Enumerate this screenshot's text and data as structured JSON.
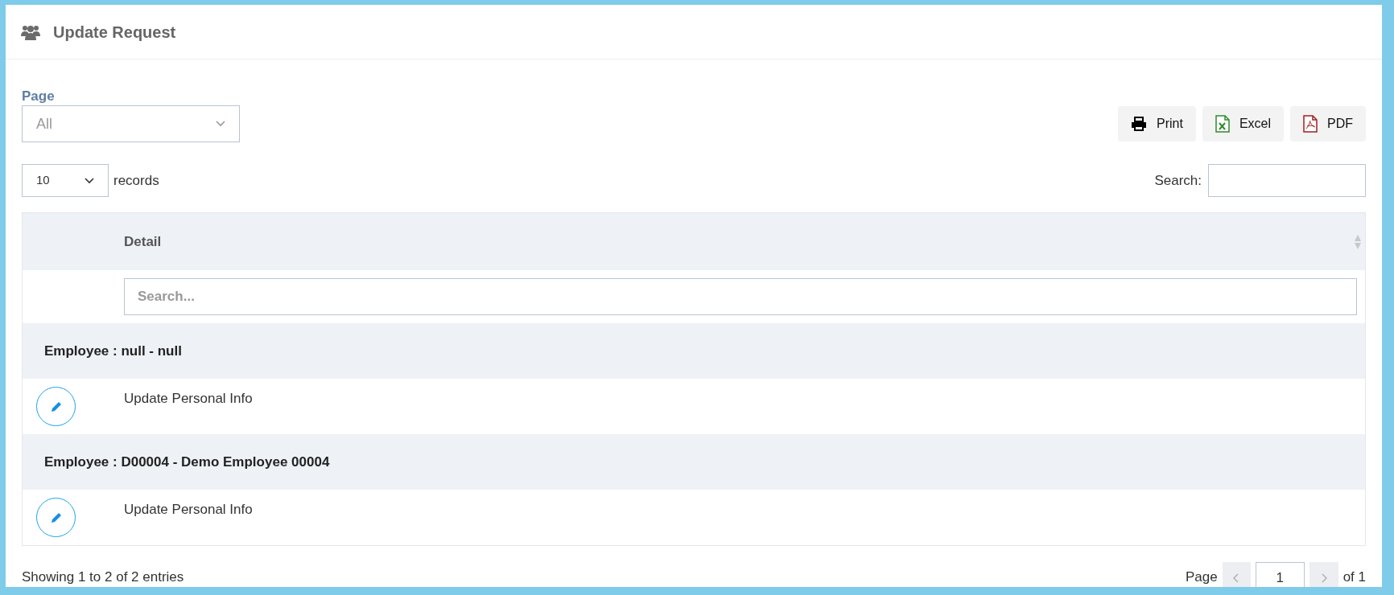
{
  "title": "Update Request",
  "filter": {
    "label": "Page",
    "value": "All"
  },
  "export_buttons": [
    {
      "kind": "print",
      "label": "Print"
    },
    {
      "kind": "excel",
      "label": "Excel"
    },
    {
      "kind": "pdf",
      "label": "PDF"
    }
  ],
  "length": {
    "value": "10",
    "suffix": "records"
  },
  "search": {
    "label": "Search:"
  },
  "table": {
    "columns": [
      {
        "label": "Detail"
      }
    ],
    "filter_placeholder": "Search...",
    "groups": [
      {
        "label": "Employee : null - null",
        "items": [
          {
            "label": "Update Personal Info"
          }
        ]
      },
      {
        "label": "Employee : D00004 - Demo Employee 00004",
        "items": [
          {
            "label": "Update Personal Info"
          }
        ]
      }
    ]
  },
  "footer": {
    "info": "Showing 1 to 2 of 2 entries",
    "pager": {
      "label": "Page",
      "page": "1",
      "of": "of 1"
    }
  }
}
